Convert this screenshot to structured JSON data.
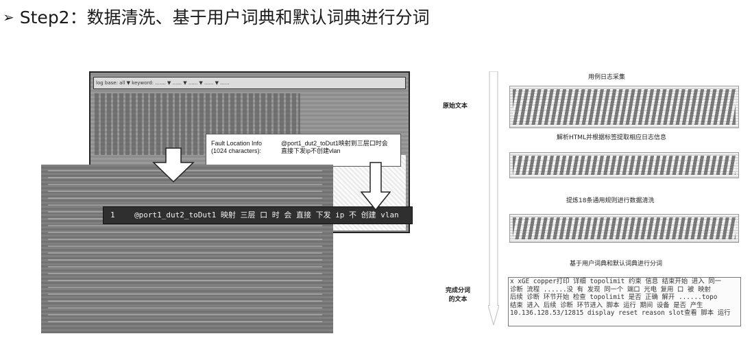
{
  "header": {
    "bullet": "➢",
    "title": "Step2：数据清洗、基于用户词典和默认词典进行分词"
  },
  "screenshot": {
    "toolbar_text": "log base: all ▼ keyword: ....... ▼ ...... ▼ ...... ▼ ...... ▼ ......",
    "info_label_line1": "Fault Location Info",
    "info_label_line2": "(1024 characters):",
    "info_value_line1": "@port1_dut2_toDut1映射到三层口时会",
    "info_value_line2": "直接下发ip不创建vlan",
    "code_line_number": "1",
    "code_line_text": "@port1_dut2_toDut1 映射 三层 口 时 会 直接 下发 ip 不 创建 vlan"
  },
  "flow": {
    "label_raw": "原始文本",
    "label_done_line1": "完成分词",
    "label_done_line2": "的文本",
    "steps": [
      {
        "label": "用例日志采集"
      },
      {
        "label": "解析HTML并根据标签提取相应日志信息"
      },
      {
        "label": "提炼18条通用规则进行数据清洗"
      },
      {
        "label": "基于用户词典和默认词典进行分词"
      }
    ],
    "segmented_lines": [
      "x xGE copper打印 详细 topolimit 约束 信息 结束开始 进入 同一",
      "诊断 流程 ......没 有 发现 同一个 端口 光电 复用 口 被 映射",
      "后续 诊断 环节开始 检查 topolimit 是否 正确 解开 ......topo",
      "结束 进入 后续 诊断 环节进入 脚本 运行 期间 设备 是否 产生",
      "10.136.128.53/12815 display reset reason slot查看 脚本 运行"
    ]
  }
}
